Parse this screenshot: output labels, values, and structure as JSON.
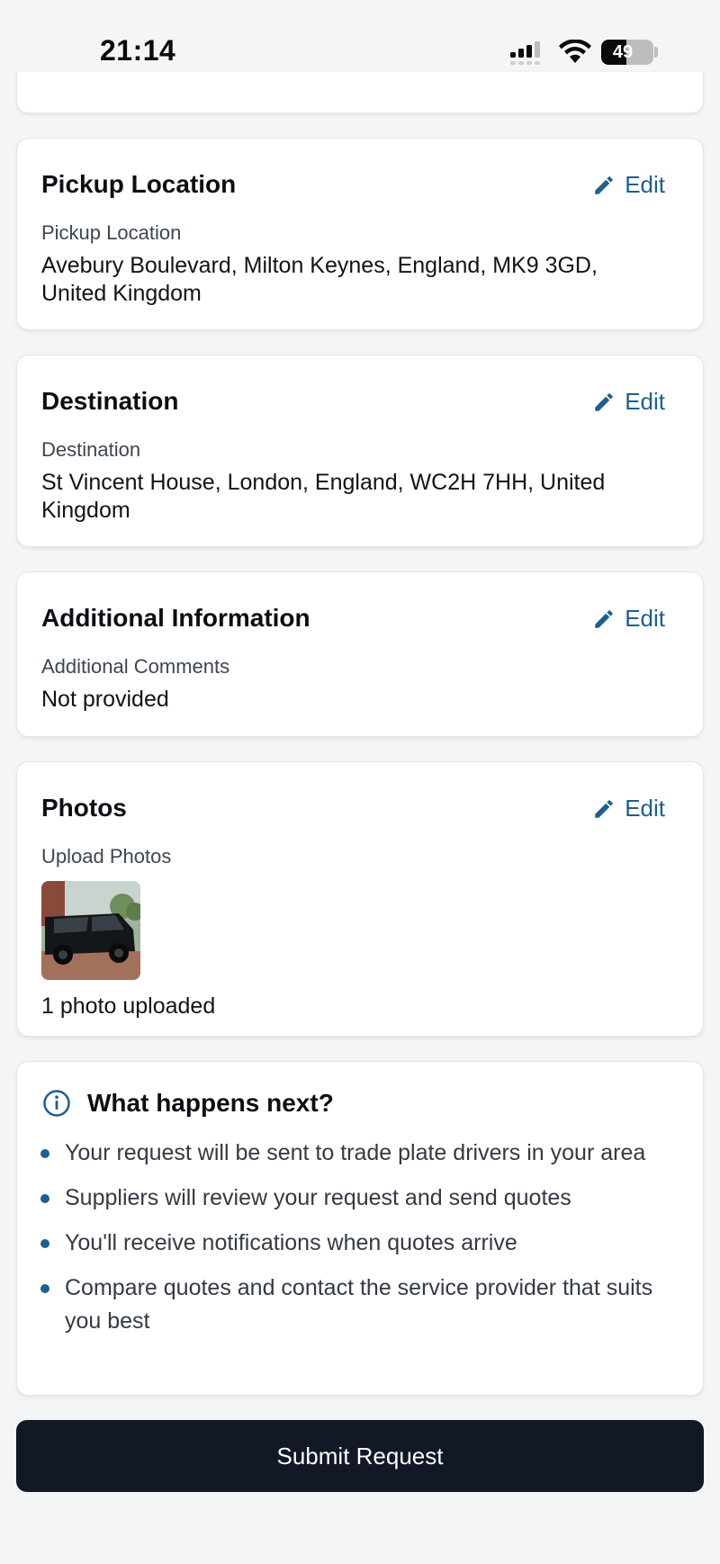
{
  "status_bar": {
    "time": "21:14",
    "battery": "49",
    "battery_level": 0.49
  },
  "pickup": {
    "title": "Pickup Location",
    "edit_label": "Edit",
    "field_label": "Pickup Location",
    "value": "Avebury Boulevard, Milton Keynes, England, MK9 3GD, United Kingdom"
  },
  "destination": {
    "title": "Destination",
    "edit_label": "Edit",
    "field_label": "Destination",
    "value": "St Vincent House, London, England, WC2H 7HH, United Kingdom"
  },
  "additional": {
    "title": "Additional Information",
    "edit_label": "Edit",
    "field_label": "Additional Comments",
    "value": "Not provided"
  },
  "photos": {
    "title": "Photos",
    "edit_label": "Edit",
    "field_label": "Upload Photos",
    "status": "1 photo uploaded"
  },
  "next_steps": {
    "title": "What happens next?",
    "items": [
      "Your request will be sent to trade plate drivers in your area",
      "Suppliers will review your request and send quotes",
      "You'll receive notifications when quotes arrive",
      "Compare quotes and contact the service provider that suits you best"
    ]
  },
  "submit_label": "Submit Request",
  "colors": {
    "accent": "#1f5f8b",
    "button": "#121826",
    "background": "#f4f5f7"
  }
}
